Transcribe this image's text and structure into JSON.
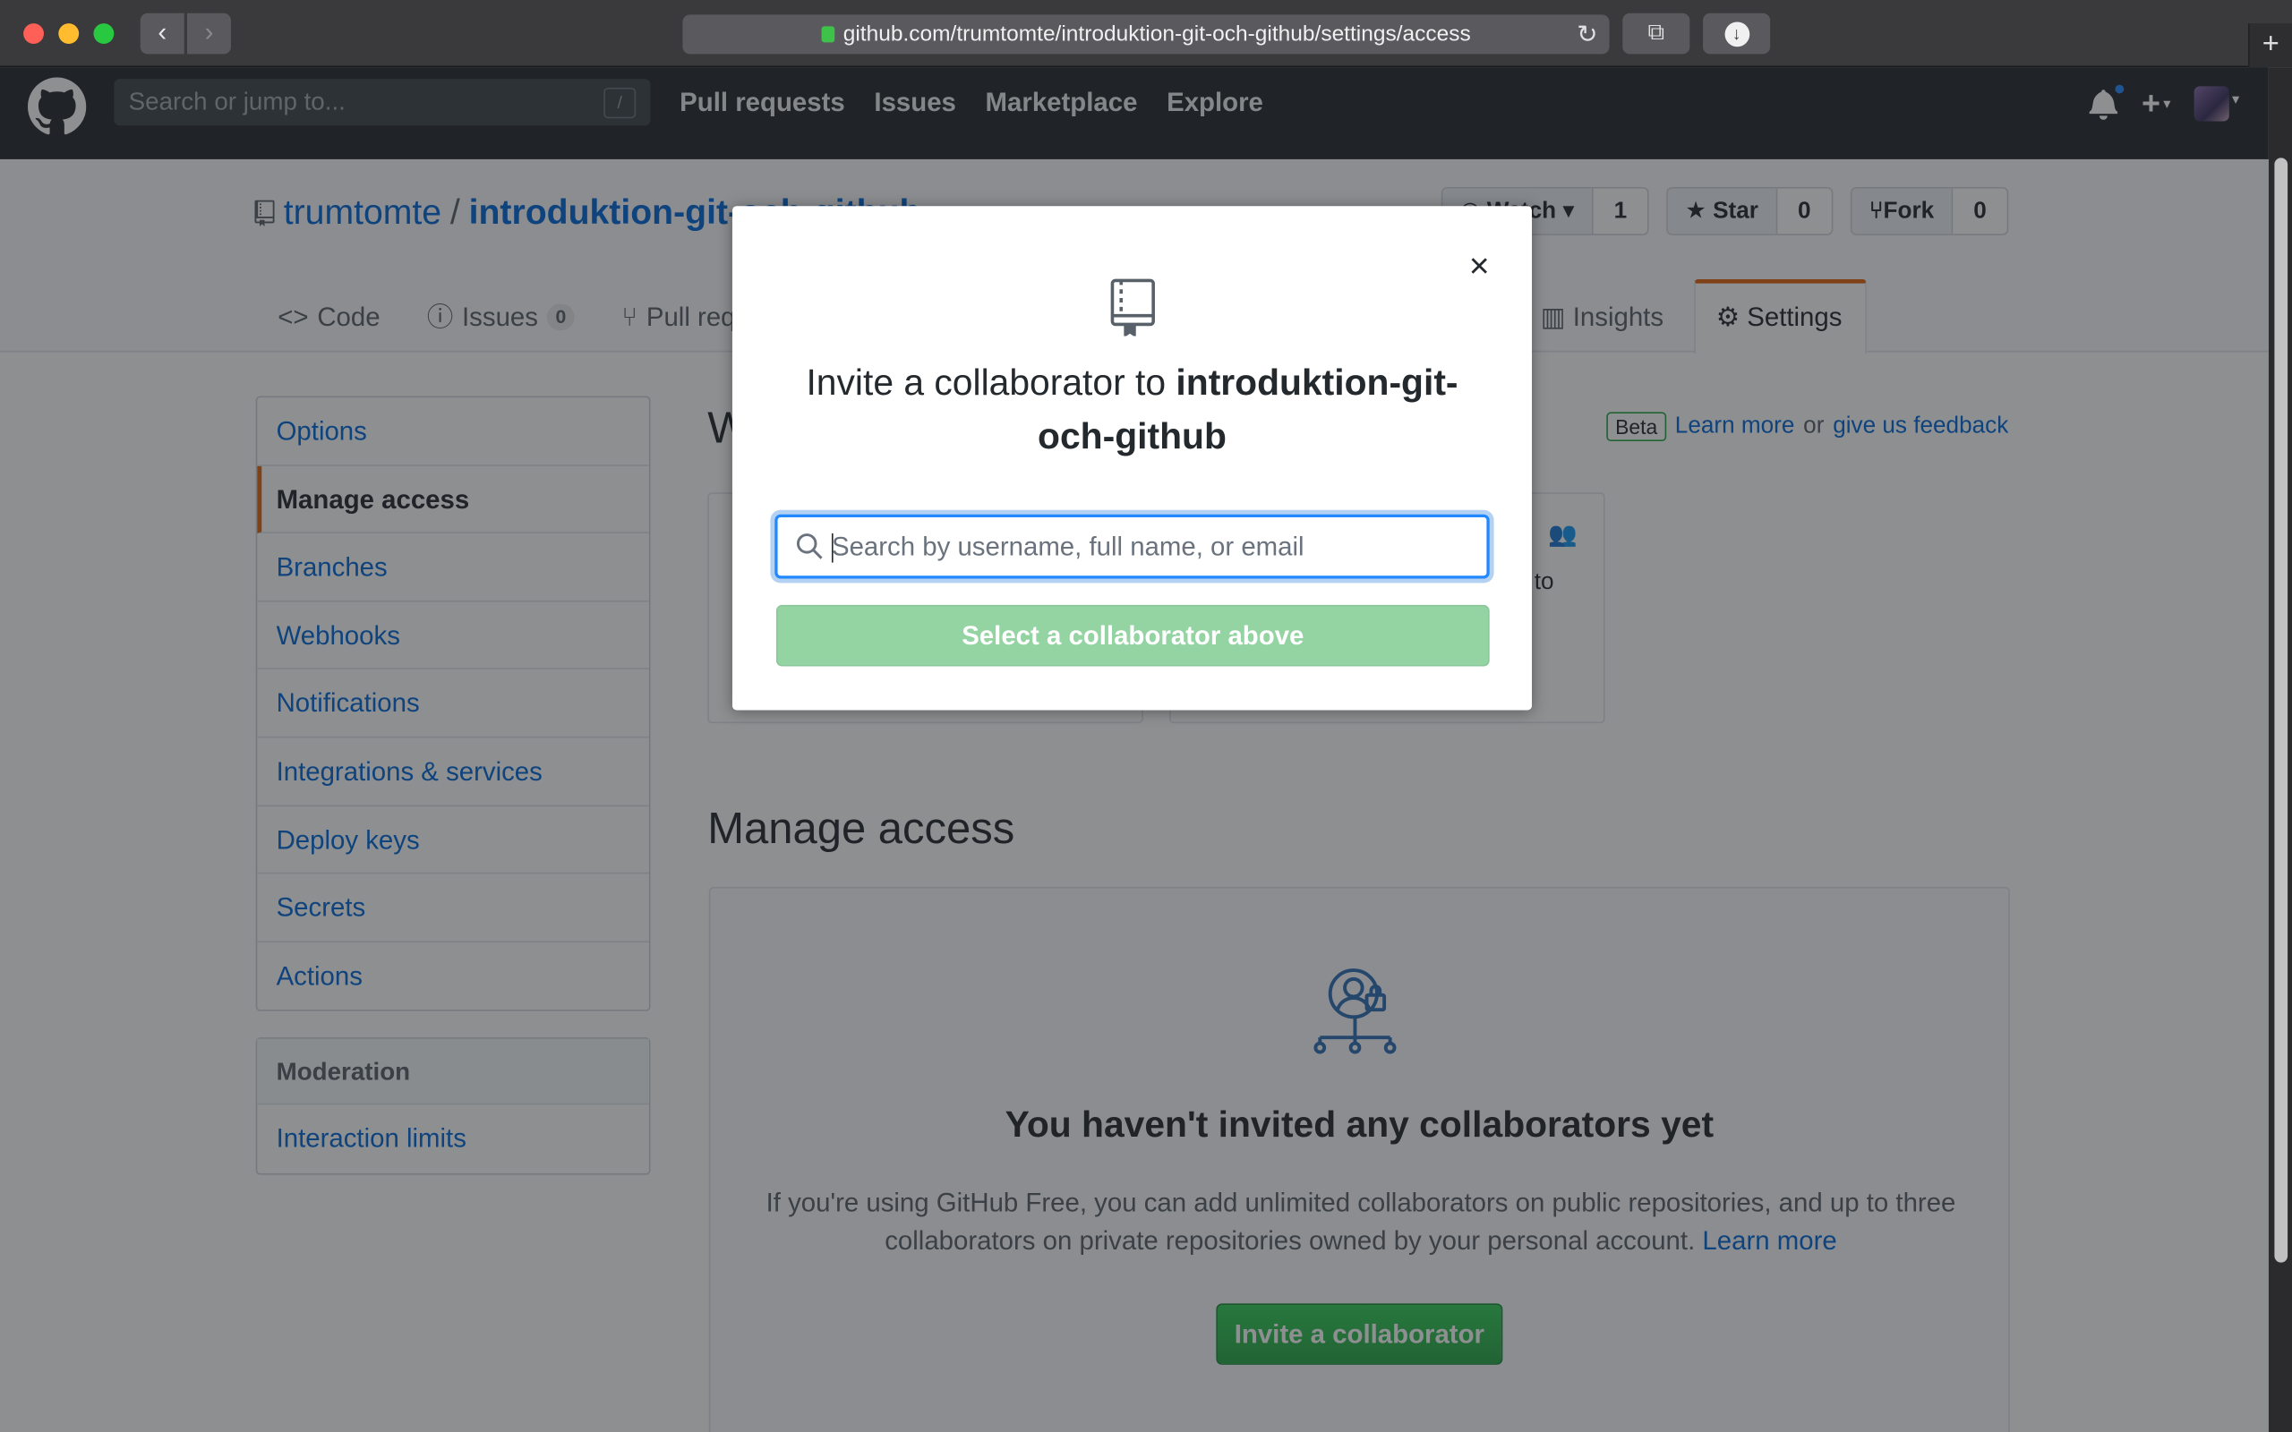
{
  "browser": {
    "url": "github.com/trumtomte/introduktion-git-och-github/settings/access"
  },
  "header": {
    "search_placeholder": "Search or jump to...",
    "search_shortcut": "/",
    "nav": [
      "Pull requests",
      "Issues",
      "Marketplace",
      "Explore"
    ]
  },
  "repo": {
    "owner": "trumtomte",
    "separator": "/",
    "name": "introduktion-git-och-github",
    "watch_label": "Watch",
    "watch_count": "1",
    "star_label": "Star",
    "star_count": "0",
    "fork_label": "Fork",
    "fork_count": "0"
  },
  "reponav": {
    "code": "Code",
    "issues": "Issues",
    "issues_count": "0",
    "pull_requests": "Pull requests",
    "insights": "Insights",
    "settings": "Settings"
  },
  "sidebar": {
    "items": [
      {
        "label": "Options"
      },
      {
        "label": "Manage access"
      },
      {
        "label": "Branches"
      },
      {
        "label": "Webhooks"
      },
      {
        "label": "Notifications"
      },
      {
        "label": "Integrations & services"
      },
      {
        "label": "Deploy keys"
      },
      {
        "label": "Secrets"
      },
      {
        "label": "Actions"
      }
    ],
    "moderation_heading": "Moderation",
    "moderation_items": [
      {
        "label": "Interaction limits"
      }
    ]
  },
  "main": {
    "beta_label": "Beta",
    "learn_more": "Learn more",
    "or_text": "or",
    "feedback": "give us feedback",
    "manage_title": "Manage access",
    "blank_title": "You haven't invited any collaborators yet",
    "blank_text": "If you're using GitHub Free, you can add unlimited collaborators on public repositories, and up to three collaborators on private repositories owned by your personal account.",
    "blank_link": "Learn more",
    "invite_button": "Invite a collaborator"
  },
  "dialog": {
    "title_prefix": "Invite a collaborator to",
    "title_repo": "introduktion-git-och-github",
    "search_placeholder": "Search by username, full name, or email",
    "search_value": "",
    "submit_label": "Select a collaborator above",
    "close_glyph": "×"
  },
  "colors": {
    "accent": "#0366d6",
    "selected_border": "#e36209",
    "success": "#28a745",
    "disabled_success": "#94d3a2"
  }
}
